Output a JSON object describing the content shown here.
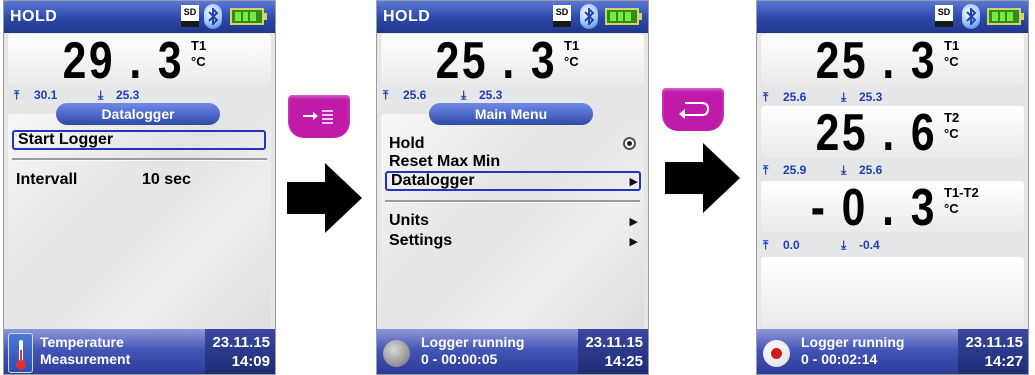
{
  "screens": [
    {
      "hold": "HOLD",
      "readings": [
        {
          "value": "29 . 3",
          "label": "T1",
          "unit": "°C",
          "max": "30.1",
          "min": "25.3"
        }
      ],
      "menu_title": "Datalogger",
      "menu": [
        {
          "label": "Start Logger"
        },
        {
          "label": "Intervall",
          "value": "10 sec"
        }
      ],
      "status": {
        "title_line1": "Temperature",
        "title_line2": "Measurement",
        "date": "23.11.15",
        "time": "14:09"
      }
    },
    {
      "hold": "HOLD",
      "readings": [
        {
          "value": "25 . 3",
          "label": "T1",
          "unit": "°C",
          "max": "25.6",
          "min": "25.3"
        }
      ],
      "menu_title": "Main Menu",
      "menu": [
        {
          "label": "Hold"
        },
        {
          "label": "Reset Max Min"
        },
        {
          "label": "Datalogger"
        },
        {
          "label": "Units"
        },
        {
          "label": "Settings"
        }
      ],
      "status": {
        "title_line1": "Logger running",
        "title_line2": "0 - 00:00:05",
        "date": "23.11.15",
        "time": "14:25"
      }
    },
    {
      "readings": [
        {
          "value": "25 . 3",
          "label": "T1",
          "unit": "°C",
          "max": "25.6",
          "min": "25.3"
        },
        {
          "value": "25 . 6",
          "label": "T2",
          "unit": "°C",
          "max": "25.9",
          "min": "25.6"
        },
        {
          "value": "- 0 . 3",
          "label": "T1-T2",
          "unit": "°C",
          "max": "0.0",
          "min": "-0.4"
        }
      ],
      "status": {
        "title_line1": "Logger running",
        "title_line2": "0 - 00:02:14",
        "date": "23.11.15",
        "time": "14:27"
      }
    }
  ],
  "colors": {
    "header_blue": "#2b48a8",
    "key_magenta": "#c01aa8",
    "selection_blue": "#2035c2",
    "minmax_blue": "#1d3fb4",
    "logger_red": "#d11a1a"
  },
  "icons": {
    "sd": "SD",
    "keys": [
      "enter-menu-key",
      "back-key"
    ],
    "flow": "right-arrow"
  }
}
